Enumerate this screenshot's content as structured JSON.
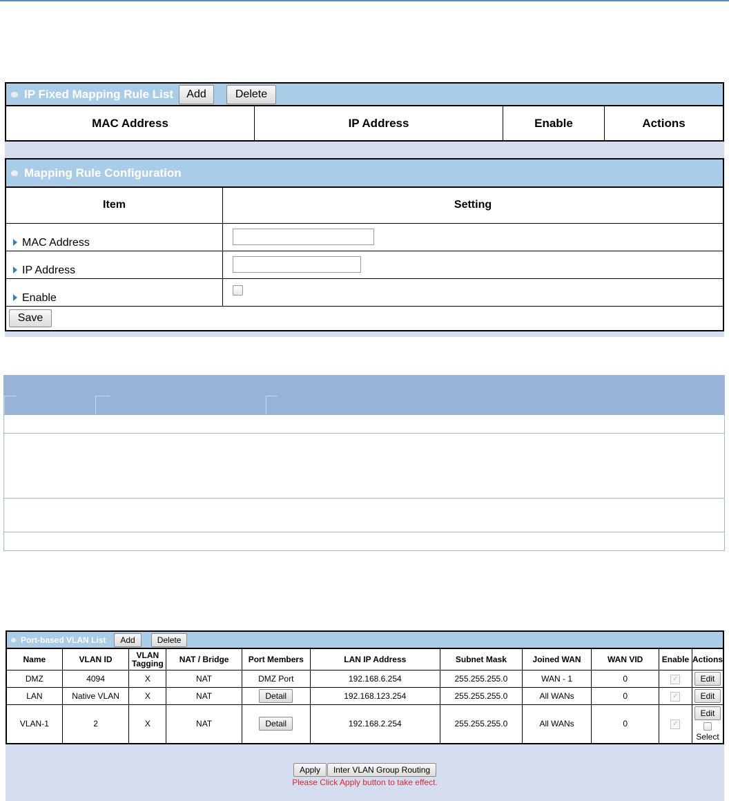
{
  "rule_list": {
    "title": "IP Fixed Mapping Rule List",
    "add_label": "Add",
    "delete_label": "Delete",
    "columns": [
      "MAC Address",
      "IP Address",
      "Enable",
      "Actions"
    ]
  },
  "config": {
    "title": "Mapping Rule Configuration",
    "col_item": "Item",
    "col_setting": "Setting",
    "rows": [
      {
        "label": "MAC Address",
        "value": ""
      },
      {
        "label": "IP Address",
        "value": ""
      },
      {
        "label": "Enable",
        "checked": false
      }
    ],
    "save_label": "Save"
  },
  "vlan": {
    "title": "Port-based VLAN List",
    "add_label": "Add",
    "delete_label": "Delete",
    "columns": [
      "Name",
      "VLAN ID",
      "VLAN Tagging",
      "NAT / Bridge",
      "Port Members",
      "LAN IP Address",
      "Subnet Mask",
      "Joined WAN",
      "WAN VID",
      "Enable",
      "Actions"
    ],
    "rows": [
      {
        "name": "DMZ",
        "vlan_id": "4094",
        "tagging": "X",
        "nat": "NAT",
        "members": "DMZ Port",
        "ip": "192.168.6.254",
        "mask": "255.255.255.0",
        "wan": "WAN - 1",
        "vid": "0",
        "action": "Edit"
      },
      {
        "name": "LAN",
        "vlan_id": "Native VLAN",
        "tagging": "X",
        "nat": "NAT",
        "members": "Detail",
        "ip": "192.168.123.254",
        "mask": "255.255.255.0",
        "wan": "All WANs",
        "vid": "0",
        "action": "Edit"
      },
      {
        "name": "VLAN-1",
        "vlan_id": "2",
        "tagging": "X",
        "nat": "NAT",
        "members": "Detail",
        "ip": "192.168.2.254",
        "mask": "255.255.255.0",
        "wan": "All WANs",
        "vid": "0",
        "action": "Edit",
        "select": "Select"
      }
    ],
    "apply_label": "Apply",
    "routing_label": "Inter VLAN Group Routing",
    "message": "Please Click Apply button to take effect.",
    "message_color": "#e0262b"
  },
  "colors": {
    "header_bg": "#a9cde8",
    "frame_bg": "#d4def0"
  }
}
